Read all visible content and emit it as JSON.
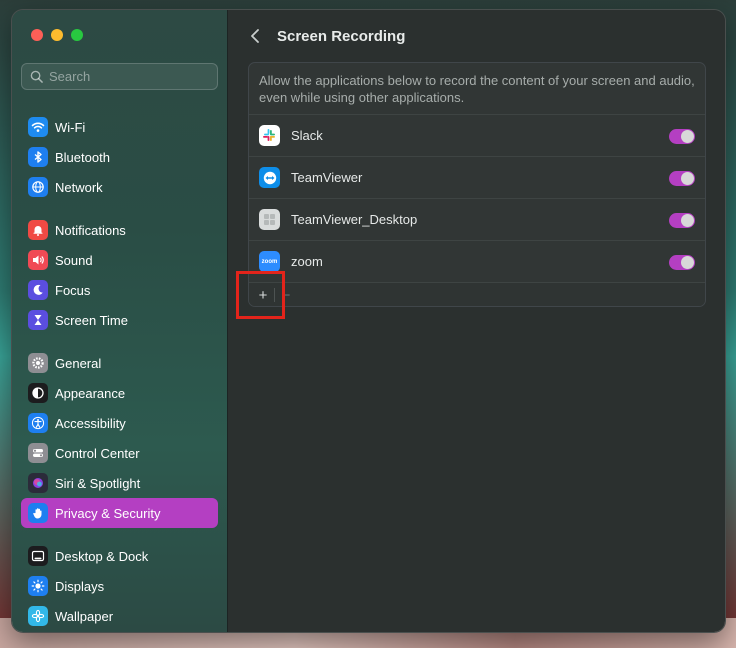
{
  "window": {
    "title": "Screen Recording"
  },
  "search": {
    "placeholder": "Search",
    "value": ""
  },
  "sidebar": {
    "groups": [
      [
        {
          "label": "Wi-Fi",
          "icon": "wifi-icon",
          "color": "#1e8bf0"
        },
        {
          "label": "Bluetooth",
          "icon": "bluetooth-icon",
          "color": "#1e7ff0"
        },
        {
          "label": "Network",
          "icon": "globe-icon",
          "color": "#1e7ff0"
        }
      ],
      [
        {
          "label": "Notifications",
          "icon": "bell-icon",
          "color": "#f04a44"
        },
        {
          "label": "Sound",
          "icon": "speaker-icon",
          "color": "#f04a55"
        },
        {
          "label": "Focus",
          "icon": "moon-icon",
          "color": "#5b4ee0"
        },
        {
          "label": "Screen Time",
          "icon": "hourglass-icon",
          "color": "#5b4ee0"
        }
      ],
      [
        {
          "label": "General",
          "icon": "gear-icon",
          "color": "#8e8e93"
        },
        {
          "label": "Appearance",
          "icon": "appearance-icon",
          "color": "#1c1c1e"
        },
        {
          "label": "Accessibility",
          "icon": "accessibility-icon",
          "color": "#1e7ff0"
        },
        {
          "label": "Control Center",
          "icon": "control-center-icon",
          "color": "#8e8e93"
        },
        {
          "label": "Siri & Spotlight",
          "icon": "siri-icon",
          "color": "#2b2b3a"
        },
        {
          "label": "Privacy & Security",
          "icon": "hand-icon",
          "color": "#1e7ff0",
          "selected": true
        }
      ],
      [
        {
          "label": "Desktop & Dock",
          "icon": "dock-icon",
          "color": "#1c1c1e"
        },
        {
          "label": "Displays",
          "icon": "sun-icon",
          "color": "#1e7ff0"
        },
        {
          "label": "Wallpaper",
          "icon": "flower-icon",
          "color": "#32b8e8"
        }
      ]
    ]
  },
  "main": {
    "description": "Allow the applications below to record the content of your screen and audio, even while using other applications.",
    "apps": [
      {
        "name": "Slack",
        "icon": "slack-icon",
        "enabled": true
      },
      {
        "name": "TeamViewer",
        "icon": "teamviewer-icon",
        "enabled": true
      },
      {
        "name": "TeamViewer_Desktop",
        "icon": "generic-app-icon",
        "enabled": true
      },
      {
        "name": "zoom",
        "icon": "zoom-icon",
        "icon_text": "zoom",
        "enabled": true
      }
    ],
    "footer": {
      "add_label": "+",
      "remove_label": "−"
    }
  },
  "colors": {
    "accent": "#b43fc2",
    "highlight": "#e3241b"
  }
}
